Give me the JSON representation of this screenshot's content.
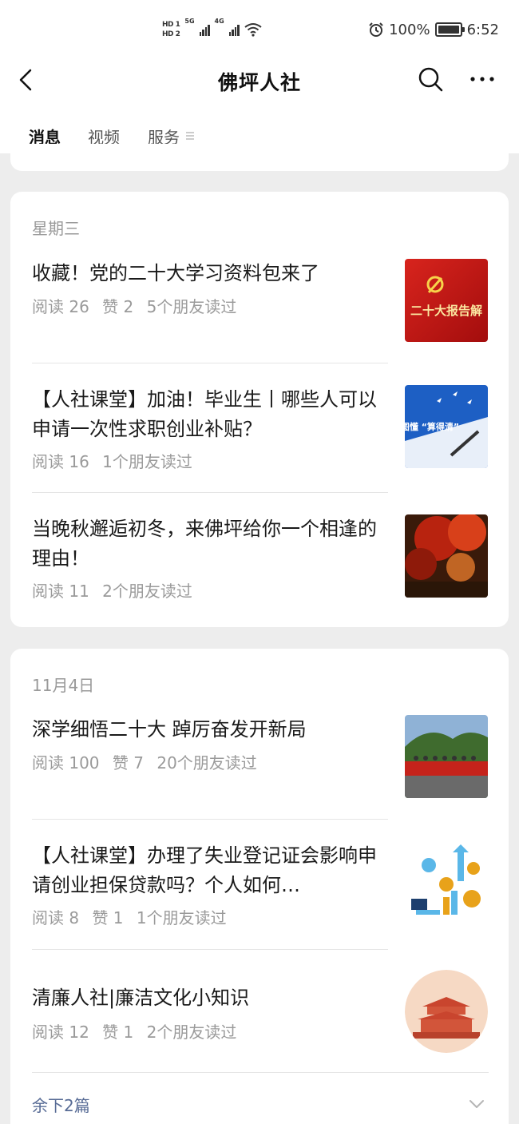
{
  "status_bar": {
    "hd1": "HD 1",
    "hd2": "HD 2",
    "net1": "5G",
    "net2": "4G",
    "battery": "100%",
    "time": "6:52",
    "icons": [
      "alarm-icon",
      "wifi-icon",
      "battery-icon",
      "signal-icon"
    ]
  },
  "nav": {
    "title": "佛坪人社",
    "icons": [
      "back-icon",
      "search-icon",
      "more-icon"
    ]
  },
  "tabs": [
    {
      "label": "消息",
      "active": true
    },
    {
      "label": "视频",
      "active": false
    },
    {
      "label": "服务",
      "active": false
    }
  ],
  "groups": [
    {
      "date": "星期三",
      "articles": [
        {
          "title": "收藏！党的二十大学习资料包来了",
          "meta": [
            "阅读 26",
            "赞 2",
            "5个朋友读过"
          ],
          "thumb_text": "二十大报告解"
        },
        {
          "title": "【人社课堂】加油！毕业生丨哪些人可以申请一次性求职创业补贴？",
          "meta": [
            "阅读 16",
            "1个朋友读过"
          ],
          "thumb_text": "看图懂 “算得清”"
        },
        {
          "title": "当晚秋邂逅初冬，来佛坪给你一个相逢的理由！",
          "meta": [
            "阅读 11",
            "2个朋友读过"
          ]
        }
      ]
    },
    {
      "date": "11月4日",
      "articles": [
        {
          "title": "深学细悟二十大 踔厉奋发开新局",
          "meta": [
            "阅读 100",
            "赞 7",
            "20个朋友读过"
          ]
        },
        {
          "title": "【人社课堂】办理了失业登记证会影响申请创业担保贷款吗？个人如何…",
          "meta": [
            "阅读 8",
            "赞 1",
            "1个朋友读过"
          ]
        },
        {
          "title": "清廉人社|廉洁文化小知识",
          "meta": [
            "阅读 12",
            "赞 1",
            "2个朋友读过"
          ]
        }
      ],
      "more_label": "余下2篇"
    }
  ],
  "colors": {
    "background": "#ededed",
    "card": "#ffffff",
    "link": "#576b95",
    "meta": "#9a9a9a"
  }
}
